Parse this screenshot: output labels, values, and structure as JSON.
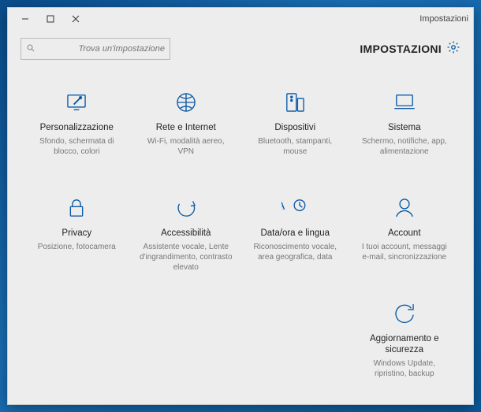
{
  "window": {
    "title": "Impostazioni"
  },
  "header": {
    "app_title": "IMPOSTAZIONI"
  },
  "search": {
    "placeholder": "Trova un'impostazione"
  },
  "tiles": {
    "system": {
      "title": "Sistema",
      "desc": "Schermo, notifiche, app, alimentazione"
    },
    "devices": {
      "title": "Dispositivi",
      "desc": "Bluetooth, stampanti, mouse"
    },
    "network": {
      "title": "Rete e Internet",
      "desc": "Wi-Fi, modalità aereo, VPN"
    },
    "personal": {
      "title": "Personalizzazione",
      "desc": "Sfondo, schermata di blocco, colori"
    },
    "accounts": {
      "title": "Account",
      "desc": "I tuoi account, messaggi e-mail, sincronizzazione"
    },
    "timelang": {
      "title": "Data/ora e lingua",
      "desc": "Riconoscimento vocale, area geografica, data"
    },
    "accessibility": {
      "title": "Accessibilità",
      "desc": "Assistente vocale, Lente d'ingrandimento, contrasto elevato"
    },
    "privacy": {
      "title": "Privacy",
      "desc": "Posizione, fotocamera"
    },
    "update": {
      "title": "Aggiornamento e sicurezza",
      "desc": "Windows Update, ripristino, backup"
    }
  },
  "colors": {
    "accent": "#0b5aa6"
  }
}
